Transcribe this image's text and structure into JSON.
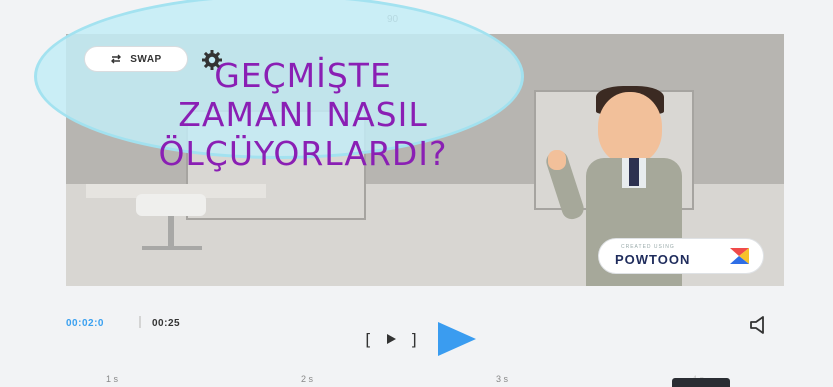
{
  "editor": {
    "frame_counter": "90"
  },
  "scene": {
    "headline_lines": [
      "GEÇMİŞTE",
      "ZAMANI NASIL",
      "ÖLÇÜYORLARDI?"
    ],
    "swap_label": "SWAP",
    "badge_small_text": "CREATED USING",
    "badge_logo": "POWTOON"
  },
  "player": {
    "current_time": "00:02:0",
    "total_time": "00:25",
    "frame_step_label_left": "[",
    "frame_step_label_right": "]",
    "accent": "#3a9cf0"
  },
  "timeline": {
    "ticks": [
      "1 s",
      "2 s",
      "3 s",
      "4 s"
    ]
  }
}
